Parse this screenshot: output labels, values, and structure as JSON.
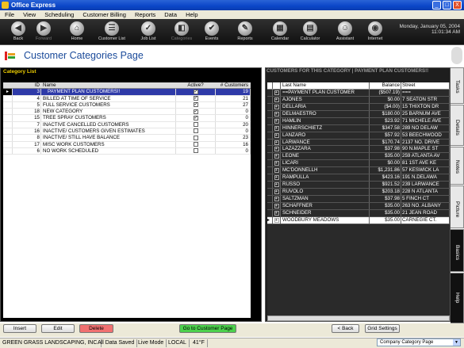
{
  "window": {
    "title": "Office Express",
    "min": "_",
    "max": "□",
    "close": "X"
  },
  "menu": [
    "File",
    "View",
    "Scheduling",
    "Customer Billing",
    "Reports",
    "Data",
    "Help"
  ],
  "toolbar": {
    "items": [
      {
        "label": "Back",
        "icon": "back-icon",
        "glyph": "◀"
      },
      {
        "label": "Forward",
        "icon": "forward-icon",
        "glyph": "▶"
      },
      {
        "label": "Home",
        "icon": "home-icon",
        "glyph": "⌂"
      },
      {
        "label": "Customer List",
        "icon": "customer-list-icon",
        "glyph": "☰"
      },
      {
        "label": "Job List",
        "icon": "job-list-icon",
        "glyph": "✓"
      },
      {
        "label": "Categories",
        "icon": "categories-icon",
        "glyph": "◧"
      },
      {
        "label": "Events",
        "icon": "events-icon",
        "glyph": "✔"
      },
      {
        "label": "Reports",
        "icon": "reports-icon",
        "glyph": "✎"
      },
      {
        "label": "Calendar",
        "icon": "calendar-icon",
        "glyph": "▦"
      },
      {
        "label": "Calculator",
        "icon": "calculator-icon",
        "glyph": "▤"
      },
      {
        "label": "Assistant",
        "icon": "assistant-icon",
        "glyph": "☺"
      },
      {
        "label": "Internet",
        "icon": "internet-icon",
        "glyph": "◉"
      }
    ],
    "date": "Monday, January 05, 2004",
    "time": "11:01:34 AM"
  },
  "page": {
    "title": "Customer Categories Page"
  },
  "category_list": {
    "caption": "Category List",
    "headers": [
      "ID",
      "Name",
      "Active?",
      "# Customers"
    ],
    "rows": [
      {
        "id": "3",
        "name": "PAYMENT PLAN CUSTOMERS!!",
        "active": "✓",
        "count": "19",
        "sel": true
      },
      {
        "id": "4",
        "name": "BILLED AT TIME OF SERVICE",
        "active": "✓",
        "count": "21"
      },
      {
        "id": "5",
        "name": "FULL SERVICE CUSTOMERS",
        "active": "✓",
        "count": "27"
      },
      {
        "id": "18",
        "name": "NEW CATEGORY",
        "active": "✓",
        "count": "0"
      },
      {
        "id": "15",
        "name": "TREE SPRAY CUSTOMERS",
        "active": "✓",
        "count": "0"
      },
      {
        "id": "7",
        "name": "INACTIVE CANCELLED CUSTOMERS",
        "active": "",
        "count": "20"
      },
      {
        "id": "16",
        "name": "INACTIVE/ CUSTOMERS GIVEN ESTIMATES",
        "active": "",
        "count": "0"
      },
      {
        "id": "8",
        "name": "INACTIVE/ STILL HAVE BALANCE",
        "active": "",
        "count": "23"
      },
      {
        "id": "17",
        "name": "MISC WORK CUSTOMERS",
        "active": "",
        "count": "16"
      },
      {
        "id": "6",
        "name": "NO WORK SCHEDULED",
        "active": "",
        "count": "0"
      }
    ]
  },
  "customers": {
    "caption": "CUSTOMERS FOR THIS CATEGORY | PAYMENT PLAN CUSTOMERS!!",
    "headers": [
      "Last Name",
      "Balance",
      "Street"
    ],
    "rows": [
      {
        "name": "==PAYMENT PLAN CUSTOMER",
        "balance": "($507.19)",
        "street": "==="
      },
      {
        "name": "AJONES",
        "balance": "$0.00",
        "street": "7 SEATON STR"
      },
      {
        "name": "DELLARIA",
        "balance": "($4.00)",
        "street": "15 THIXTON DR"
      },
      {
        "name": "DELMAESTRO",
        "balance": "$180.00",
        "street": "25 BARNUM AVE"
      },
      {
        "name": "HAMLIN",
        "balance": "$23.92",
        "street": "71 MICHELE AVE"
      },
      {
        "name": "HINNERSCHIETZ",
        "balance": "$347.58",
        "street": "289 NO DELAW"
      },
      {
        "name": "LANZARO",
        "balance": "$57.92",
        "street": "53 BEECHWOOD"
      },
      {
        "name": "LARWANCE",
        "balance": "$170.74",
        "street": "2137 NO. DRIVE"
      },
      {
        "name": "LAZAZZARA",
        "balance": "$37.98",
        "street": "90 N.MAPLE ST"
      },
      {
        "name": "LEONE",
        "balance": "$35.00",
        "street": "259 ATLANTA AV"
      },
      {
        "name": "LICARI",
        "balance": "$0.00",
        "street": "81 1ST AVE KE"
      },
      {
        "name": "MC'DONNELLH",
        "balance": "$1,231.86",
        "street": "57 KESWICK LA"
      },
      {
        "name": "RAMPULLA",
        "balance": "$423.16",
        "street": "191 N.DELAWA"
      },
      {
        "name": "RUSSO",
        "balance": "$921.52",
        "street": "239 LARWANCE"
      },
      {
        "name": "RUVOLO",
        "balance": "$203.18",
        "street": "228 N ATLANTA"
      },
      {
        "name": "SALTZMAN",
        "balance": "$37.98",
        "street": "5 FINCH CT"
      },
      {
        "name": "SCHAFFNER",
        "balance": "$35.00",
        "street": "263 NO. ALBANY"
      },
      {
        "name": "SCHNEIDER",
        "balance": "$35.00",
        "street": "21 JEAN ROAD"
      },
      {
        "name": "WOODBURY MEADOWS",
        "balance": "$35.00",
        "street": "CARNEGIE CT."
      }
    ]
  },
  "side_tabs": [
    "Tasks",
    "Details",
    "Notes",
    "Picture",
    "Basics",
    "Help"
  ],
  "buttons": {
    "insert": "Insert",
    "edit": "Edit",
    "delete": "Delete",
    "goto": "Go to Customer Page",
    "back": "< Back",
    "grid": "Grid Settings"
  },
  "status": {
    "company": "GREEN GRASS LANDSCAPING, INC.",
    "saved": "All Data Saved",
    "mode": "Live Mode",
    "db": "LOCAL",
    "temp": "41°F",
    "page_select": "Company Category Page"
  },
  "colors": {
    "accent": "#2e3aa8",
    "delete": "#f07070",
    "goto": "#4cd04c"
  }
}
